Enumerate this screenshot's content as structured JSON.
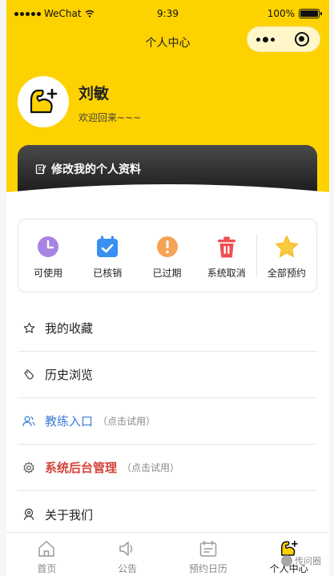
{
  "status_bar": {
    "carrier": "WeChat",
    "time": "9:39",
    "battery": "100%"
  },
  "navbar": {
    "title": "个人中心"
  },
  "colors": {
    "brand_yellow": "#fed200",
    "link_blue": "#3b7bd6",
    "admin_red": "#d7423a"
  },
  "user": {
    "name": "刘敏",
    "greeting": "欢迎回来~~~"
  },
  "profile_card": {
    "label": "修改我的个人资料",
    "icon": "edit-icon"
  },
  "order_status": [
    {
      "label": "可使用",
      "icon": "clock-icon"
    },
    {
      "label": "已核销",
      "icon": "calendar-check-icon"
    },
    {
      "label": "已过期",
      "icon": "alert-icon"
    },
    {
      "label": "系统取消",
      "icon": "trash-icon"
    },
    {
      "label": "全部预约",
      "icon": "star-icon"
    }
  ],
  "menu": [
    {
      "label": "我的收藏",
      "hint": "",
      "icon": "star-outline-icon"
    },
    {
      "label": "历史浏览",
      "hint": "",
      "icon": "tag-icon"
    },
    {
      "label": "教练入口",
      "hint": "（点击试用）",
      "icon": "users-icon"
    },
    {
      "label": "系统后台管理",
      "hint": "（点击试用）",
      "icon": "gear-icon"
    },
    {
      "label": "关于我们",
      "hint": "",
      "icon": "about-icon"
    }
  ],
  "tabbar": [
    {
      "label": "首页",
      "icon": "home-icon",
      "active": false
    },
    {
      "label": "公告",
      "icon": "speaker-icon",
      "active": false
    },
    {
      "label": "预约日历",
      "icon": "calendar-icon",
      "active": false
    },
    {
      "label": "个人中心",
      "icon": "profile-icon",
      "active": true
    }
  ],
  "watermark": "传问圈"
}
